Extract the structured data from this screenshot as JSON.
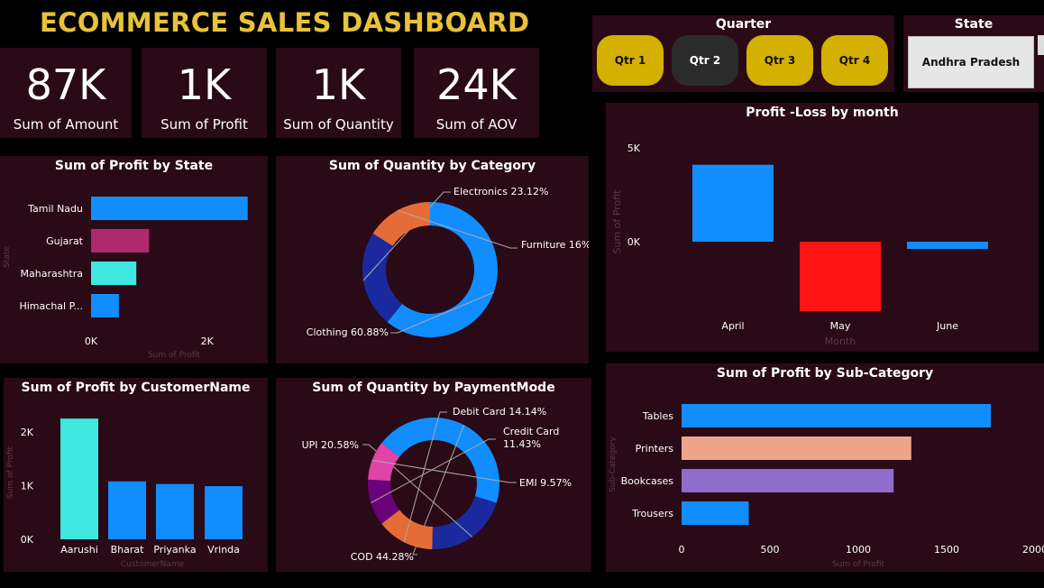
{
  "header": {
    "title": "ECOMMERCE SALES DASHBOARD"
  },
  "kpis": [
    {
      "value": "87K",
      "label": "Sum of Amount"
    },
    {
      "value": "1K",
      "label": "Sum of Profit"
    },
    {
      "value": "1K",
      "label": "Sum of Quantity"
    },
    {
      "value": "24K",
      "label": "Sum of AOV"
    }
  ],
  "quarter_slicer": {
    "title": "Quarter",
    "options": [
      "Qtr 1",
      "Qtr 2",
      "Qtr 3",
      "Qtr 4"
    ],
    "selected": "Qtr 2"
  },
  "state_slicer": {
    "title": "State",
    "value": "Andhra Pradesh"
  },
  "colors": {
    "accent": "#e8c23a",
    "panel": "#2a0a16",
    "blue": "#118dff",
    "red": "#ff1414"
  },
  "chart_data": [
    {
      "id": "profit_by_state",
      "type": "bar",
      "orientation": "horizontal",
      "title": "Sum of Profit by State",
      "xlabel": "Sum of Profit",
      "ylabel": "State",
      "categories": [
        "Tamil Nadu",
        "Gujarat",
        "Maharashtra",
        "Himachal P..."
      ],
      "values": [
        2700,
        1000,
        780,
        480
      ],
      "colors": [
        "#118dff",
        "#b0296d",
        "#3ee8df",
        "#118dff"
      ],
      "xticks": [
        "0K",
        "2K"
      ],
      "xlim": [
        0,
        3000
      ]
    },
    {
      "id": "quantity_by_category",
      "type": "pie",
      "donut": true,
      "title": "Sum of Quantity by Category",
      "slices": [
        {
          "name": "Clothing",
          "value": 60.88,
          "label": "Clothing 60.88%",
          "color": "#118dff"
        },
        {
          "name": "Electronics",
          "value": 23.12,
          "label": "Electronics 23.12%",
          "color": "#1a2a9e"
        },
        {
          "name": "Furniture",
          "value": 16,
          "label": "Furniture 16%",
          "color": "#e66c37"
        }
      ]
    },
    {
      "id": "profit_loss_by_month",
      "type": "bar",
      "title": "Profit -Loss by month",
      "xlabel": "Month",
      "ylabel": "Sum of Profit",
      "categories": [
        "April",
        "May",
        "June"
      ],
      "values": [
        4100,
        -3700,
        -300
      ],
      "colors": [
        "#118dff",
        "#ff1414",
        "#118dff"
      ],
      "yticks": [
        "5K",
        "0K"
      ],
      "ylim": [
        -5000,
        5000
      ]
    },
    {
      "id": "profit_by_customer",
      "type": "bar",
      "title": "Sum of Profit by CustomerName",
      "xlabel": "CustomerName",
      "ylabel": "Sum of Profit",
      "categories": [
        "Aarushi",
        "Bharat",
        "Priyanka",
        "Vrinda"
      ],
      "values": [
        2250,
        1080,
        1030,
        990
      ],
      "colors": [
        "#3ee8df",
        "#118dff",
        "#118dff",
        "#118dff"
      ],
      "yticks": [
        "0K",
        "1K",
        "2K"
      ],
      "ylim": [
        0,
        2400
      ]
    },
    {
      "id": "quantity_by_payment",
      "type": "pie",
      "donut": true,
      "title": "Sum of Quantity by PaymentMode",
      "slices": [
        {
          "name": "COD",
          "value": 44.28,
          "label": "COD 44.28%",
          "color": "#118dff"
        },
        {
          "name": "UPI",
          "value": 20.58,
          "label": "UPI 20.58%",
          "color": "#1a2a9e"
        },
        {
          "name": "Debit Card",
          "value": 14.14,
          "label": "Debit Card 14.14%",
          "color": "#e66c37"
        },
        {
          "name": "Credit Card",
          "value": 11.43,
          "label": "Credit Card\n11.43%",
          "color": "#6b007b"
        },
        {
          "name": "EMI",
          "value": 9.57,
          "label": "EMI 9.57%",
          "color": "#e044a7"
        }
      ]
    },
    {
      "id": "profit_by_subcategory",
      "type": "bar",
      "orientation": "horizontal",
      "title": "Sum of Profit by Sub-Category",
      "xlabel": "Sum of Profit",
      "ylabel": "Sub-Category",
      "categories": [
        "Tables",
        "Printers",
        "Bookcases",
        "Trousers"
      ],
      "values": [
        1750,
        1300,
        1200,
        380
      ],
      "colors": [
        "#118dff",
        "#f0a58a",
        "#8f6bcc",
        "#118dff"
      ],
      "xticks": [
        "0",
        "500",
        "1000",
        "1500",
        "2000"
      ],
      "xlim": [
        0,
        2000
      ]
    }
  ]
}
